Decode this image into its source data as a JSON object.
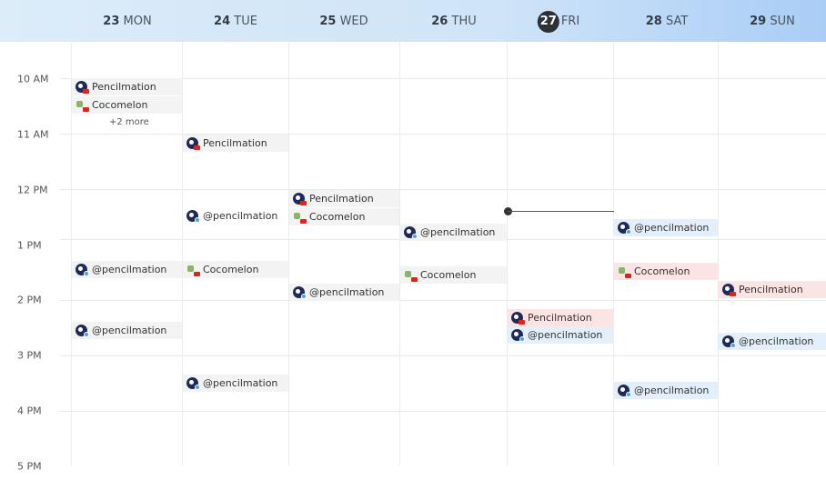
{
  "days": [
    {
      "num": "23",
      "name": "MON"
    },
    {
      "num": "24",
      "name": "TUE"
    },
    {
      "num": "25",
      "name": "WED"
    },
    {
      "num": "26",
      "name": "THU"
    },
    {
      "num": "27",
      "name": "FRI"
    },
    {
      "num": "28",
      "name": "SAT"
    },
    {
      "num": "29",
      "name": "SUN"
    }
  ],
  "times": [
    "10 AM",
    "11 AM",
    "12 PM",
    "1 PM",
    "2 PM",
    "3 PM",
    "4 PM",
    "5 PM"
  ],
  "events": {
    "mon_pencil": "Pencilmation",
    "mon_coco": "Cocomelon",
    "mon_more": "+2 more",
    "mon_tw1": "@pencilmation",
    "mon_tw2": "@pencilmation",
    "tue_pencil": "Pencilmation",
    "tue_tw1": "@pencilmation",
    "tue_coco": "Cocomelon",
    "tue_tw2": "@pencilmation",
    "wed_pencil": "Pencilmation",
    "wed_coco": "Cocomelon",
    "wed_tw": "@pencilmation",
    "thu_tw": "@pencilmation",
    "thu_coco": "Cocomelon",
    "fri_pencil": "Pencilmation",
    "fri_tw": "@pencilmation",
    "sat_tw1": "@pencilmation",
    "sat_coco": "Cocomelon",
    "sat_tw2": "@pencilmation",
    "sun_pencil": "Pencilmation",
    "sun_tw": "@pencilmation"
  },
  "colors": {
    "youtube": "#e62117",
    "twitter": "#49a1eb",
    "today": "#2e3236",
    "pink_event": "#fde4e4",
    "blue_event": "#e3f0fc",
    "grey_event": "#f3f3f3"
  },
  "icons": {
    "pencilmation_youtube": "pencilmation-youtube-icon",
    "pencilmation_twitter": "pencilmation-twitter-icon",
    "cocomelon_youtube": "cocomelon-youtube-icon"
  }
}
